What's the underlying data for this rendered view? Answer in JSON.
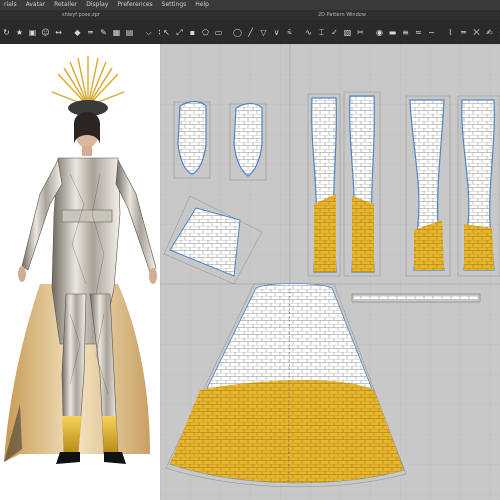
{
  "menu": {
    "items": [
      "rials",
      "Avatar",
      "Retailer",
      "Display",
      "Preferences",
      "Settings",
      "Help"
    ]
  },
  "titles": {
    "file_name": "shleyf pose.zpr",
    "pattern_window": "2D Pattern Window"
  },
  "toolbar_3d": {
    "icons": [
      "rotate-icon",
      "pose-icon",
      "camera-icon",
      "avatar-icon",
      "measure-icon",
      "pin-icon",
      "tape-icon",
      "trace-icon",
      "grid-icon",
      "arrange-icon",
      "fold-icon",
      "tack-icon",
      "shape-icon",
      "capture-icon",
      "points-icon"
    ]
  },
  "toolbar_2d": {
    "icons": [
      "select-icon",
      "transform-icon",
      "edit-point-icon",
      "polygon-icon",
      "rectangle-icon",
      "circle-icon",
      "internal-line-icon",
      "dart-icon",
      "notch-icon",
      "segment-sew-icon",
      "free-sew-icon",
      "fold-sew-icon",
      "check-sewing-icon",
      "texture-icon",
      "trim-icon",
      "button-icon",
      "buttonhole-icon",
      "zipper-icon",
      "piping-icon",
      "puckering-icon",
      "elastic-icon",
      "tape-icon",
      "shirring-icon",
      "annotation-icon",
      "graphic-icon",
      "symmetry-icon",
      "grading-icon",
      "fabric-icon"
    ]
  },
  "colors": {
    "gold": "#e8b52c",
    "outline_blue": "#4f86c6",
    "pattern_bg": "#c8c8c8",
    "ui_dark": "#2a2a2a"
  }
}
